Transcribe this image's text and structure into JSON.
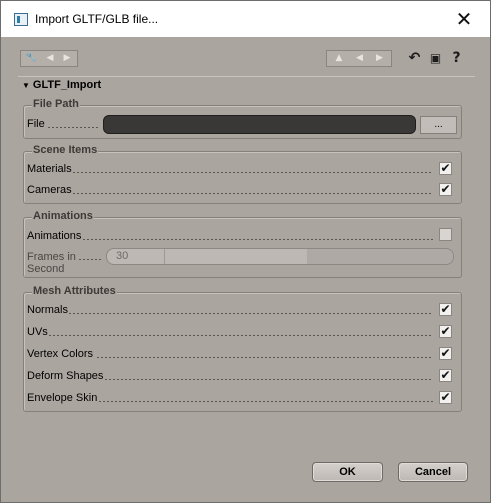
{
  "window": {
    "title": "Import GLTF/GLB file...",
    "close_glyph": "✕"
  },
  "toolbar": {
    "left_icons": [
      "tools-icon",
      "back-arrow-icon",
      "forward-arrow-icon"
    ],
    "right_icons": [
      "up-arrow-icon",
      "left-arrow-icon",
      "right-arrow-icon"
    ],
    "action_icons": [
      "undo-icon",
      "window-icon",
      "help-icon"
    ]
  },
  "section": {
    "title": "GLTF_Import"
  },
  "file_path": {
    "title": "File Path",
    "file_label": "File",
    "file_value": "",
    "browse_label": "..."
  },
  "scene_items": {
    "title": "Scene Items",
    "rows": [
      {
        "label": "Materials",
        "checked": true
      },
      {
        "label": "Cameras",
        "checked": true
      }
    ]
  },
  "animations": {
    "title": "Animations",
    "animations_label": "Animations",
    "animations_checked": false,
    "fps_label_line1": "Frames in",
    "fps_label_line2": "Second",
    "fps_value": "30"
  },
  "mesh_attributes": {
    "title": "Mesh Attributes",
    "rows": [
      {
        "label": "Normals",
        "checked": true
      },
      {
        "label": "UVs",
        "checked": true
      },
      {
        "label": "Vertex Colors",
        "checked": true
      },
      {
        "label": "Deform Shapes",
        "checked": true
      },
      {
        "label": "Envelope Skin",
        "checked": true
      }
    ]
  },
  "buttons": {
    "ok": "OK",
    "cancel": "Cancel"
  },
  "check_glyph": "✔"
}
